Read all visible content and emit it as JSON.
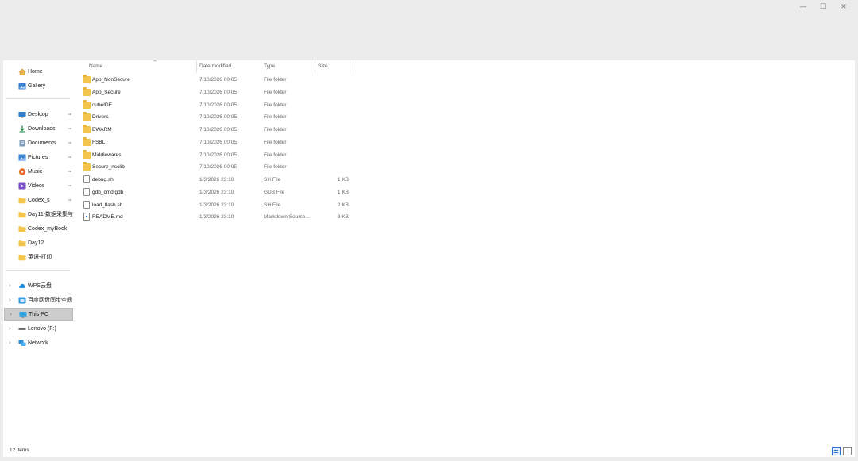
{
  "window": {
    "controls": {
      "minimize": "—",
      "maximize": "☐",
      "close": "✕"
    }
  },
  "nav": {
    "items": [
      {
        "key": "home",
        "label": "Home",
        "icon": "home-icon",
        "pinned": false,
        "chevron": false,
        "selected": false
      },
      {
        "key": "gallery",
        "label": "Gallery",
        "icon": "gallery-icon",
        "pinned": false,
        "chevron": false,
        "selected": false
      },
      {
        "key": "desktop",
        "label": "Desktop",
        "icon": "desktop-icon",
        "pinned": true,
        "chevron": false,
        "selected": false
      },
      {
        "key": "downloads",
        "label": "Downloads",
        "icon": "downloads-icon",
        "pinned": true,
        "chevron": false,
        "selected": false
      },
      {
        "key": "documents",
        "label": "Documents",
        "icon": "documents-icon",
        "pinned": true,
        "chevron": false,
        "selected": false
      },
      {
        "key": "pictures",
        "label": "Pictures",
        "icon": "pictures-icon",
        "pinned": true,
        "chevron": false,
        "selected": false
      },
      {
        "key": "music",
        "label": "Music",
        "icon": "music-icon",
        "pinned": true,
        "chevron": false,
        "selected": false
      },
      {
        "key": "videos",
        "label": "Videos",
        "icon": "videos-icon",
        "pinned": true,
        "chevron": false,
        "selected": false
      },
      {
        "key": "codex-s",
        "label": "Codex_s",
        "icon": "folder-icon",
        "pinned": true,
        "chevron": false,
        "selected": false
      },
      {
        "key": "day11",
        "label": "Day11-数据采集与",
        "icon": "folder-icon",
        "pinned": false,
        "chevron": false,
        "selected": false
      },
      {
        "key": "codex-mybook",
        "label": "Codex_myBook",
        "icon": "folder-icon",
        "pinned": false,
        "chevron": false,
        "selected": false
      },
      {
        "key": "day12",
        "label": "Day12",
        "icon": "folder-icon",
        "pinned": false,
        "chevron": false,
        "selected": false
      },
      {
        "key": "english-print",
        "label": "英语-打印",
        "icon": "folder-icon",
        "pinned": false,
        "chevron": false,
        "selected": false
      },
      {
        "key": "wps-cloud",
        "label": "WPS云盘",
        "icon": "cloud-icon",
        "pinned": false,
        "chevron": true,
        "selected": false
      },
      {
        "key": "baidu-sync",
        "label": "百度网盘同步空间",
        "icon": "sync-drive-icon",
        "pinned": false,
        "chevron": true,
        "selected": false
      },
      {
        "key": "this-pc",
        "label": "This PC",
        "icon": "this-pc-icon",
        "pinned": false,
        "chevron": true,
        "selected": true
      },
      {
        "key": "lenovo-drive",
        "label": "Lenovo (F:)",
        "icon": "drive-icon",
        "pinned": false,
        "chevron": true,
        "selected": false
      },
      {
        "key": "network",
        "label": "Network",
        "icon": "network-icon",
        "pinned": false,
        "chevron": true,
        "selected": false
      }
    ],
    "pin_glyph": "📌",
    "chevron_glyph": "›"
  },
  "columns": {
    "name": "Name",
    "date": "Date modified",
    "type": "Type",
    "size": "Size",
    "sort_glyph": "^"
  },
  "files": [
    {
      "name": "App_NonSecure",
      "date": "7/10/2026 00:05",
      "type": "File folder",
      "size": "",
      "kind": "folder"
    },
    {
      "name": "App_Secure",
      "date": "7/10/2026 00:05",
      "type": "File folder",
      "size": "",
      "kind": "folder"
    },
    {
      "name": "cubeIDE",
      "date": "7/10/2026 00:05",
      "type": "File folder",
      "size": "",
      "kind": "folder"
    },
    {
      "name": "Drivers",
      "date": "7/10/2026 00:05",
      "type": "File folder",
      "size": "",
      "kind": "folder"
    },
    {
      "name": "EWARM",
      "date": "7/10/2026 00:05",
      "type": "File folder",
      "size": "",
      "kind": "folder"
    },
    {
      "name": "FSBL",
      "date": "7/10/2026 00:05",
      "type": "File folder",
      "size": "",
      "kind": "folder"
    },
    {
      "name": "Middlewares",
      "date": "7/10/2026 00:05",
      "type": "File folder",
      "size": "",
      "kind": "folder"
    },
    {
      "name": "Secure_nsclib",
      "date": "7/10/2026 00:05",
      "type": "File folder",
      "size": "",
      "kind": "folder"
    },
    {
      "name": "debug.sh",
      "date": "1/3/2026 23:10",
      "type": "SH File",
      "size": "1 KB",
      "kind": "file"
    },
    {
      "name": "gdb_cmd.gdb",
      "date": "1/3/2026 23:10",
      "type": "GDB File",
      "size": "1 KB",
      "kind": "file"
    },
    {
      "name": "load_flash.sh",
      "date": "1/3/2026 23:10",
      "type": "SH File",
      "size": "2 KB",
      "kind": "file"
    },
    {
      "name": "README.md",
      "date": "1/3/2026 23:10",
      "type": "Markdown Source...",
      "size": "9 KB",
      "kind": "markdown"
    }
  ],
  "status": {
    "item_count": "12 items"
  },
  "colors": {
    "folder": "#f3c54a",
    "selected_nav": "#cccccc",
    "accent": "#2a6fd6"
  }
}
